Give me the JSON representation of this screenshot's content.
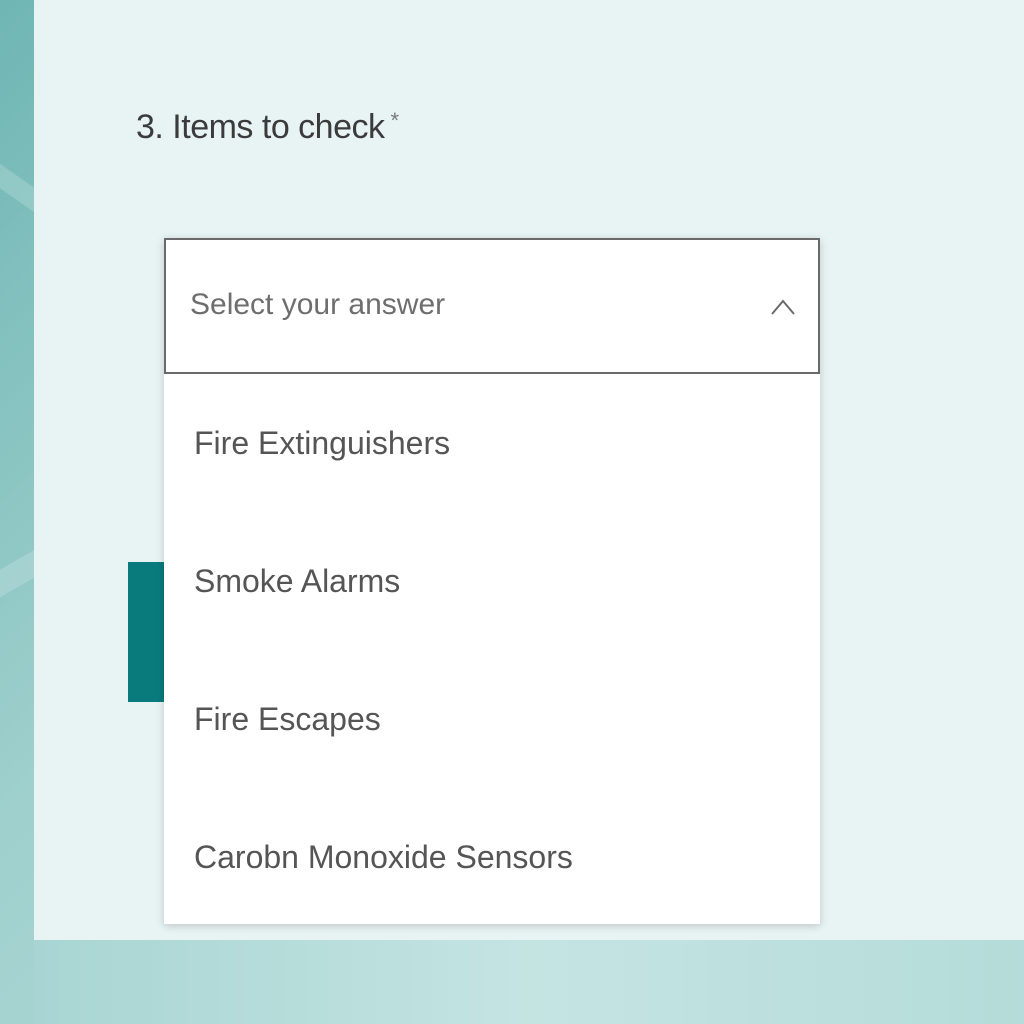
{
  "question": {
    "title": "3. Items to check",
    "required_marker": "*"
  },
  "dropdown": {
    "placeholder": "Select your answer",
    "expanded": true,
    "options": [
      "Fire Extinguishers",
      "Smoke Alarms",
      "Fire Escapes",
      "Carobn Monoxide Sensors"
    ]
  },
  "colors": {
    "accent": "#0a7b7d",
    "panel_background": "#e8f3f3",
    "dropdown_border": "#6a6a6a"
  },
  "icons": {
    "dropdown_toggle": "chevron-up-icon"
  }
}
